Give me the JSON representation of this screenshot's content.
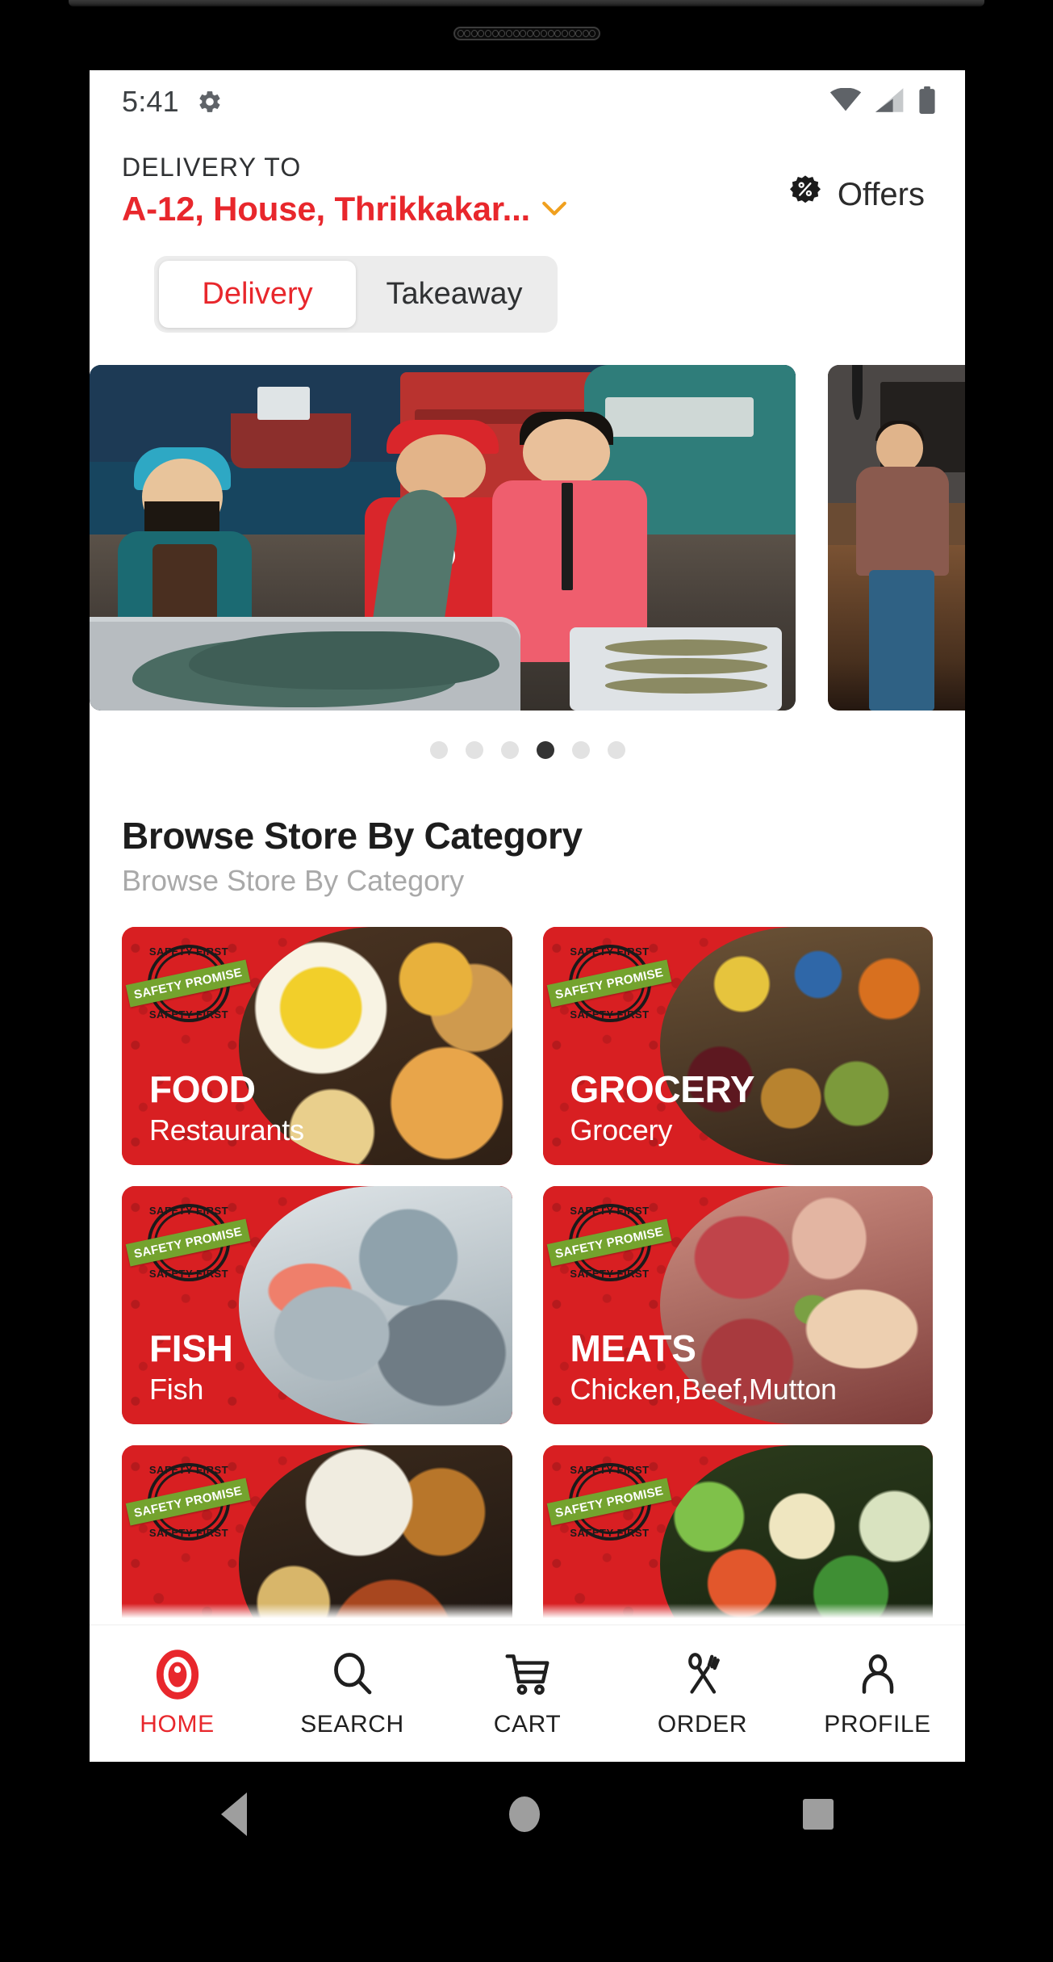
{
  "status_bar": {
    "time": "5:41",
    "icons": [
      "gear-icon",
      "wifi-icon",
      "cellular-signal-icon",
      "battery-icon"
    ]
  },
  "header": {
    "delivery_label": "DELIVERY TO",
    "address": "A-12, House, Thrikkakar...",
    "chevron_icon": "chevron-down-icon",
    "offers_label": "Offers",
    "offers_icon": "percent-badge-icon",
    "accent_color": "#e8272c"
  },
  "mode_toggle": {
    "options": [
      {
        "label": "Delivery",
        "active": true
      },
      {
        "label": "Takeaway",
        "active": false
      }
    ]
  },
  "carousel": {
    "slides": [
      {
        "alt": "Fishermen at dock handing over fresh fish to delivery agent"
      },
      {
        "alt": "Man standing inside a restaurant interior"
      }
    ],
    "dots": {
      "count": 6,
      "active_index": 3
    }
  },
  "browse_section": {
    "title": "Browse Store By Category",
    "subtitle": "Browse Store By Category"
  },
  "categories": [
    {
      "title": "FOOD",
      "subtitle": "Restaurants",
      "corner_color": "#f08020",
      "photo_class": "ph-food",
      "badge_ring_color": "#1a1a1a"
    },
    {
      "title": "GROCERY",
      "subtitle": "Grocery",
      "corner_color": "#e01f25",
      "photo_class": "ph-groc",
      "badge_ring_color": "#1a1a1a"
    },
    {
      "title": "FISH",
      "subtitle": "Fish",
      "corner_color": "#2fc0b4",
      "photo_class": "ph-fish",
      "badge_ring_color": "#1a1a1a"
    },
    {
      "title": "MEATS",
      "subtitle": "Chicken,Beef,Mutton",
      "corner_color": "#22b63a",
      "photo_class": "ph-meat",
      "badge_ring_color": "#1a1a1a"
    },
    {
      "title": "",
      "subtitle": "",
      "corner_color": "#a659c4",
      "photo_class": "ph-meals",
      "badge_ring_color": "#1a1a1a"
    },
    {
      "title": "",
      "subtitle": "",
      "corner_color": "#f2c21a",
      "photo_class": "ph-veg",
      "badge_ring_color": "#1a1a1a"
    }
  ],
  "safety_badge": {
    "top_text": "SAFETY FIRST",
    "ribbon_text": "SAFETY PROMISE",
    "bottom_text": "SAFETY FIRST",
    "ribbon_color": "#74a32e"
  },
  "bottom_nav": [
    {
      "label": "HOME",
      "icon": "location-pin-icon",
      "active": true
    },
    {
      "label": "SEARCH",
      "icon": "magnifier-icon",
      "active": false
    },
    {
      "label": "CART",
      "icon": "shopping-cart-icon",
      "active": false
    },
    {
      "label": "ORDER",
      "icon": "fork-and-spoon-icon",
      "active": false
    },
    {
      "label": "PROFILE",
      "icon": "person-icon",
      "active": false
    }
  ],
  "android_nav": [
    {
      "label": "back",
      "icon": "back-triangle-icon"
    },
    {
      "label": "home",
      "icon": "home-circle-icon"
    },
    {
      "label": "recents",
      "icon": "recents-square-icon"
    }
  ]
}
